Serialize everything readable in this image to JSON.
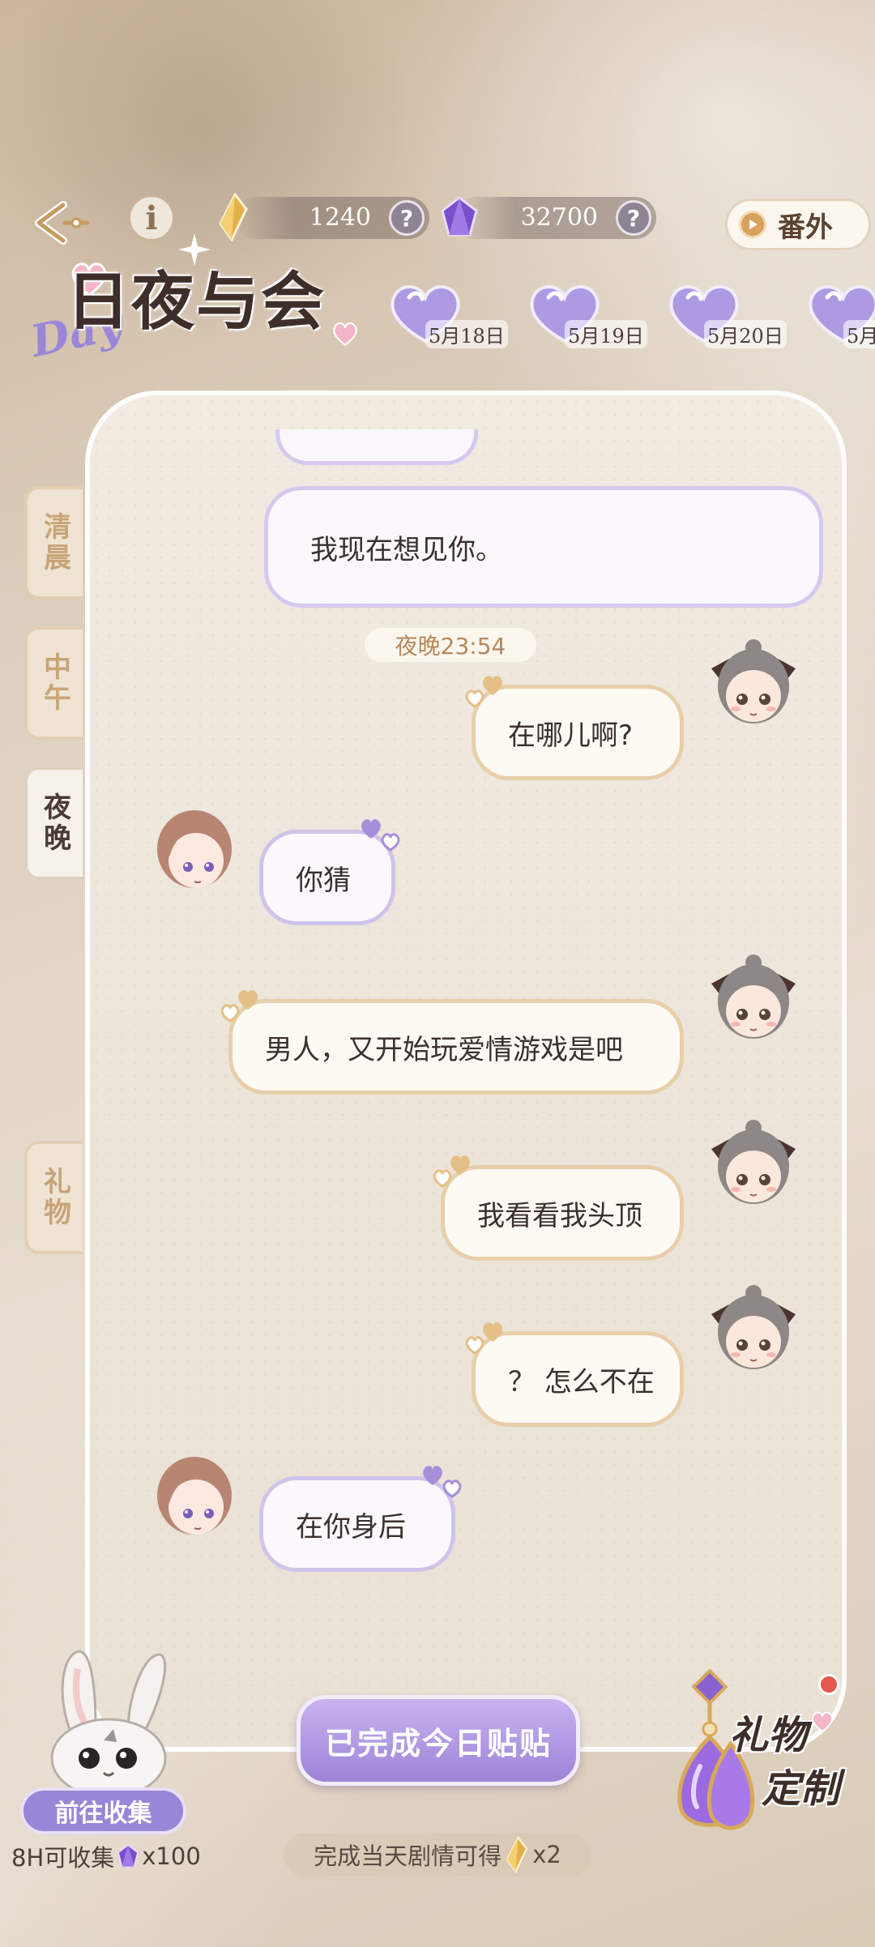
{
  "top_bar": {
    "gold_amount": "1240",
    "purple_amount": "32700",
    "help_glyph": "?",
    "info_glyph": "i",
    "extra_label": "番外"
  },
  "logo": {
    "title": "日夜与会",
    "day_text": "Day"
  },
  "dates": [
    "5月18日",
    "5月19日",
    "5月20日",
    "5月"
  ],
  "side_tabs": {
    "morning": "清晨",
    "noon": "中午",
    "night": "夜晚",
    "gift": "礼物",
    "active": "night"
  },
  "chat": {
    "partial_message": "我现在想见你。",
    "timestamp": "夜晚23:54",
    "messages": [
      {
        "from": "me",
        "text": "在哪儿啊?"
      },
      {
        "from": "him",
        "text": "你猜"
      },
      {
        "from": "me",
        "text": "男人，又开始玩爱情游戏是吧"
      },
      {
        "from": "me",
        "text": "我看看我头顶"
      },
      {
        "from": "me",
        "text": "？ 怎么不在"
      },
      {
        "from": "him",
        "text": "在你身后"
      }
    ]
  },
  "bottom": {
    "complete_button": "已完成今日贴贴",
    "reward_text_prefix": "完成当天剧情可得",
    "reward_text_suffix": "x2",
    "collect_button": "前往收集",
    "collect_sub_prefix": "8H可收集",
    "collect_sub_suffix": "x100",
    "gift_custom_line1": "礼物",
    "gift_custom_line2": "定制"
  },
  "colors": {
    "accent_purple": "#9d84d8",
    "accent_gold": "#e7cfa9",
    "timestamp_text": "#b6875c"
  }
}
